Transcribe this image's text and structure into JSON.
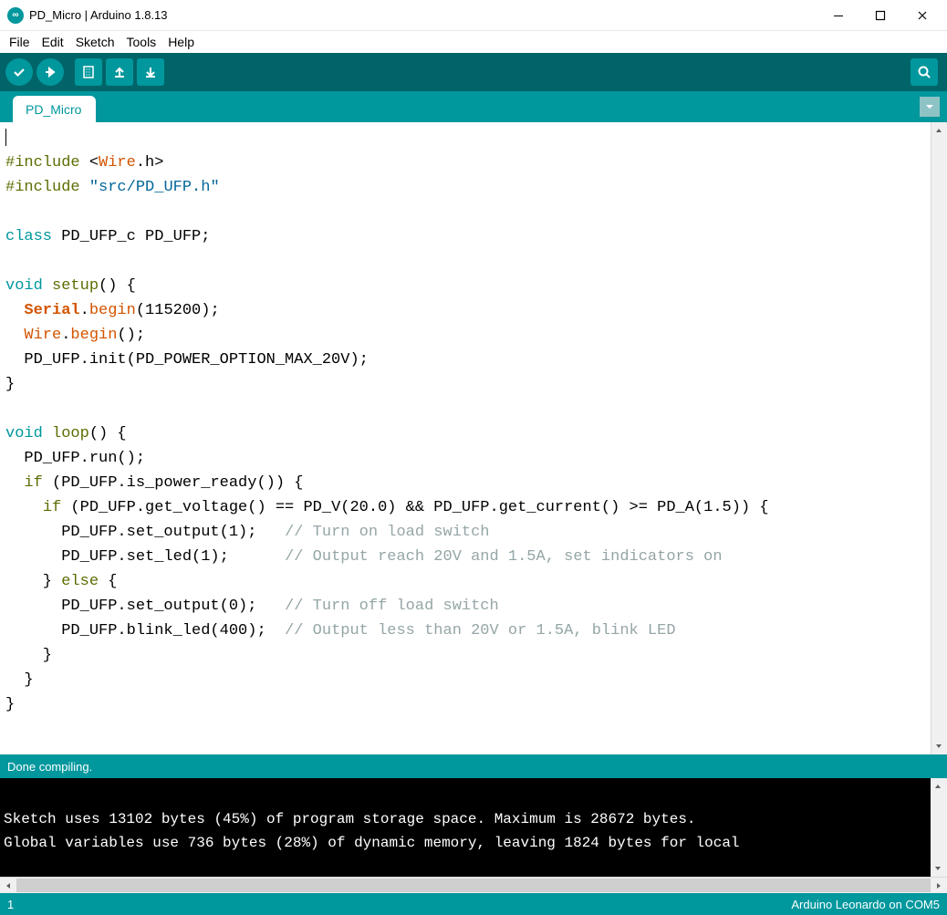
{
  "app_icon_text": "∞",
  "title": "PD_Micro | Arduino 1.8.13",
  "menus": [
    "File",
    "Edit",
    "Sketch",
    "Tools",
    "Help"
  ],
  "tab": {
    "label": "PD_Micro"
  },
  "status": {
    "message": "Done compiling."
  },
  "console": {
    "line1": "Sketch uses 13102 bytes (45%) of program storage space. Maximum is 28672 bytes.",
    "line2": "Global variables use 736 bytes (28%) of dynamic memory, leaving 1824 bytes for local "
  },
  "footer": {
    "line": "1",
    "board": "Arduino Leonardo on COM5"
  },
  "code": {
    "l1_a": "#include",
    "l1_b": " <",
    "l1_c": "Wire",
    "l1_d": ".h>",
    "l2_a": "#include",
    "l2_b": " \"src/PD_UFP.h\"",
    "l3_a": "class",
    "l3_b": " PD_UFP_c PD_UFP;",
    "l4_a": "void",
    "l4_b": " ",
    "l4_c": "setup",
    "l4_d": "() {",
    "l5_a": "  ",
    "l5_b": "Serial",
    "l5_c": ".",
    "l5_d": "begin",
    "l5_e": "(115200);",
    "l6_a": "  ",
    "l6_b": "Wire",
    "l6_c": ".",
    "l6_d": "begin",
    "l6_e": "();",
    "l7_a": "  PD_UFP.init(PD_POWER_OPTION_MAX_20V);",
    "l8_a": "}",
    "l9_a": "void",
    "l9_b": " ",
    "l9_c": "loop",
    "l9_d": "() {",
    "l10_a": "  PD_UFP.run();",
    "l11_a": "  ",
    "l11_b": "if",
    "l11_c": " (PD_UFP.is_power_ready()) {",
    "l12_a": "    ",
    "l12_b": "if",
    "l12_c": " (PD_UFP.get_voltage() == PD_V(20.0) && PD_UFP.get_current() >= PD_A(1.5)) {",
    "l13_a": "      PD_UFP.set_output(1);   ",
    "l13_b": "// Turn on load switch",
    "l14_a": "      PD_UFP.set_led(1);      ",
    "l14_b": "// Output reach 20V and 1.5A, set indicators on",
    "l15_a": "    } ",
    "l15_b": "else",
    "l15_c": " {",
    "l16_a": "      PD_UFP.set_output(0);   ",
    "l16_b": "// Turn off load switch",
    "l17_a": "      PD_UFP.blink_led(400);  ",
    "l17_b": "// Output less than 20V or 1.5A, blink LED",
    "l18_a": "    }",
    "l19_a": "  }",
    "l20_a": "}"
  }
}
